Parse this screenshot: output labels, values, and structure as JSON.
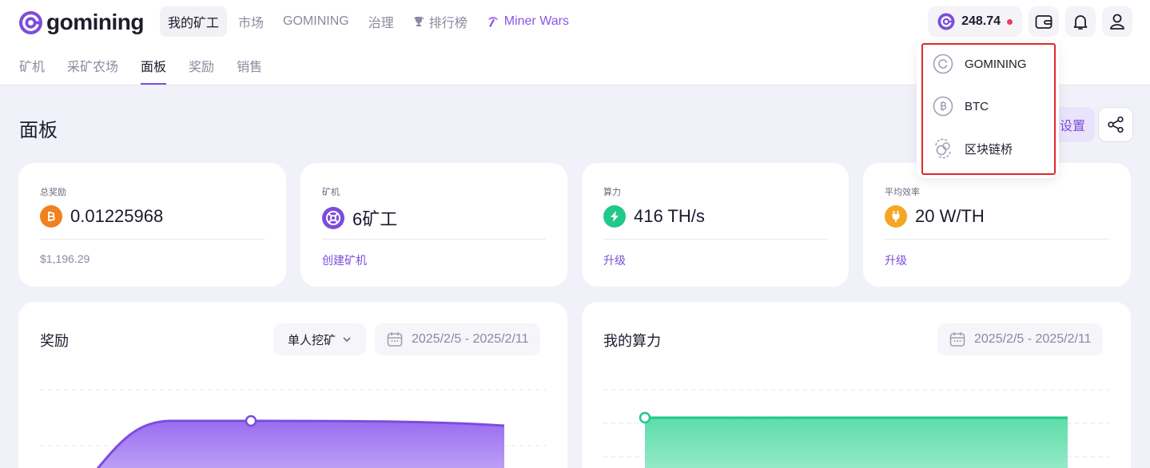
{
  "logo": {
    "text": "gomining"
  },
  "nav": [
    {
      "label": "我的矿工",
      "active": true
    },
    {
      "label": "市场"
    },
    {
      "label": "GOMINING"
    },
    {
      "label": "治理"
    },
    {
      "label": "排行榜",
      "icon": "trophy-icon"
    },
    {
      "label": "Miner Wars",
      "icon": "pickaxe-icon"
    }
  ],
  "subnav": [
    {
      "label": "矿机"
    },
    {
      "label": "采矿农场"
    },
    {
      "label": "面板",
      "active": true
    },
    {
      "label": "奖励"
    },
    {
      "label": "销售"
    }
  ],
  "wallet": {
    "balance": "248.74"
  },
  "dropdown": {
    "items": [
      {
        "label": "GOMINING",
        "icon": "gomining-coin-icon"
      },
      {
        "label": "BTC",
        "icon": "btc-coin-icon"
      },
      {
        "label": "区块链桥",
        "icon": "bridge-icon"
      }
    ]
  },
  "page": {
    "title": "面板",
    "settings_label": "设置"
  },
  "stats": [
    {
      "label": "总奖励",
      "value": "0.01225968",
      "footer": "$1,196.29",
      "icon": "bitcoin-icon",
      "color": "#f0811e"
    },
    {
      "label": "矿机",
      "value": "6矿工",
      "footer": "创建矿机",
      "icon": "miner-icon",
      "color": "#7c4ddc"
    },
    {
      "label": "算力",
      "value": "416 TH/s",
      "footer": "升级",
      "icon": "bolt-icon",
      "color": "#20c98a"
    },
    {
      "label": "平均效率",
      "value": "20 W/TH",
      "footer": "升级",
      "icon": "plug-icon",
      "color": "#f5a623"
    }
  ],
  "rewards_chart": {
    "title": "奖励",
    "mode": "单人挖矿",
    "date_range": "2025/2/5 - 2025/2/11"
  },
  "hashrate_chart": {
    "title": "我的算力",
    "date_range": "2025/2/5 - 2025/2/11"
  },
  "colors": {
    "accent": "#7c4ddc",
    "green": "#20c98a",
    "alert": "#ef3a5d"
  }
}
